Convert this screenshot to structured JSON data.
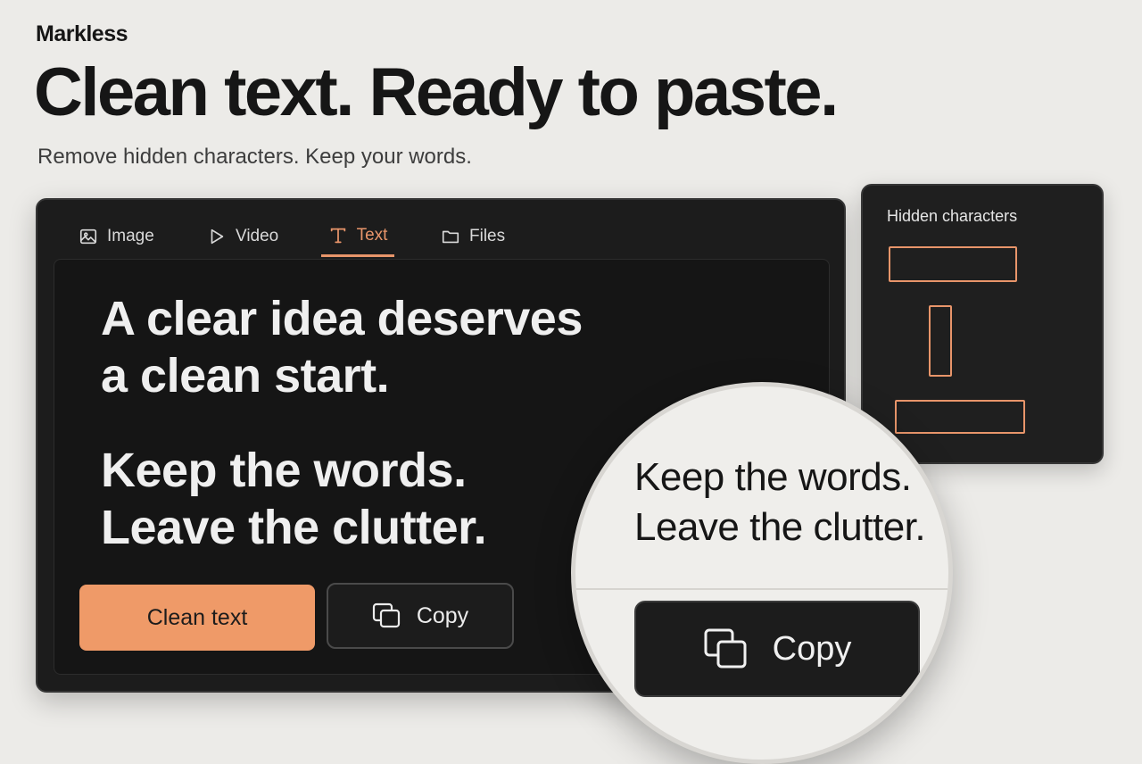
{
  "app": {
    "brand": "Markless"
  },
  "hero": {
    "headline": "Clean text. Ready to paste.",
    "subheadline": "Remove hidden characters. Keep your words."
  },
  "editor": {
    "tabs": [
      {
        "label": "Image",
        "icon": "image-icon",
        "active": false
      },
      {
        "label": "Video",
        "icon": "play-icon",
        "active": false
      },
      {
        "label": "Text",
        "icon": "text-t-icon",
        "active": true
      },
      {
        "label": "Files",
        "icon": "folder-icon",
        "active": false
      }
    ],
    "paragraphs": [
      [
        "A clear idea deserves",
        "a clean start."
      ],
      [
        "Keep the words.",
        "Leave the clutter."
      ]
    ],
    "clean_button_label": "Clean text",
    "copy_button_label": "Copy"
  },
  "hidden_panel": {
    "title": "Hidden characters"
  },
  "zoom": {
    "lines": [
      "Keep the words.",
      "Leave the clutter."
    ],
    "copy_button_label": "Copy"
  },
  "colors": {
    "accent": "#e8956a",
    "clean_button": "#ef9a68",
    "panel_bg": "#1c1c1c",
    "page_bg": "#ecebe8"
  }
}
